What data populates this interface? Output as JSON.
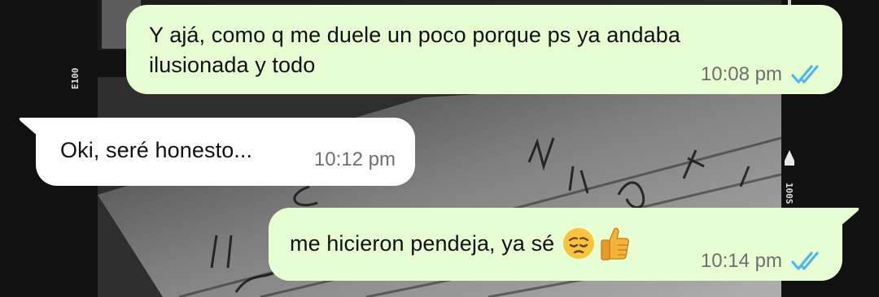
{
  "messages": [
    {
      "direction": "outgoing",
      "lines": [
        "Y ajá, como q me duele un poco porque ps ya andaba",
        "ilusionada y todo"
      ],
      "time": "10:08 pm",
      "status": "read"
    },
    {
      "direction": "incoming",
      "lines": [
        "Oki, seré honesto..."
      ],
      "time": "10:12 pm"
    },
    {
      "direction": "outgoing",
      "lines": [
        "me hicieron pendeja, ya sé"
      ],
      "emojis": [
        "pensive-face",
        "thumbs-up"
      ],
      "time": "10:14 pm",
      "status": "read"
    }
  ],
  "wallpaper": {
    "film_marks": [
      "E100",
      "100S"
    ]
  },
  "colors": {
    "outgoing_bubble": "#e7fed2",
    "incoming_bubble": "#ffffff",
    "read_ticks": "#4fb6ec",
    "timestamp": "#6f6f6f"
  }
}
